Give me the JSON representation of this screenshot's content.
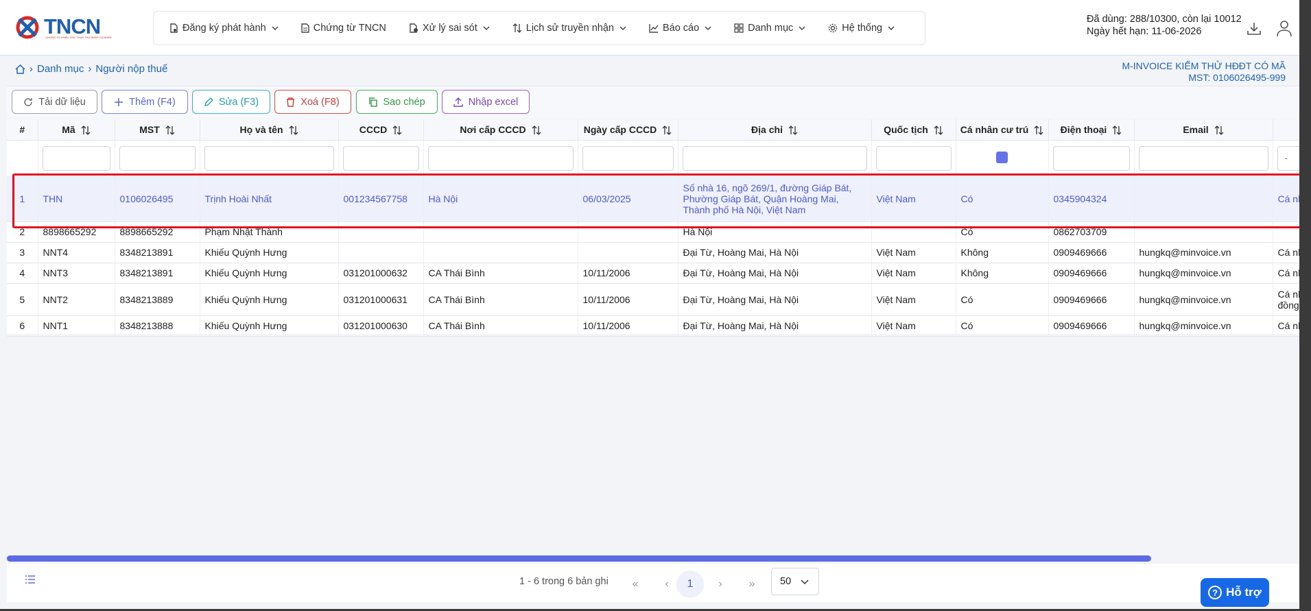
{
  "logo": {
    "text": "TNCN",
    "subtitle": "CHỨNG TỪ KHẤU TRỪ THUẾ THU NHẬP CÁ NHÂN"
  },
  "nav": [
    {
      "label": "Đăng ký phát hành",
      "icon": "file-settings-icon",
      "dropdown": true
    },
    {
      "label": "Chứng từ TNCN",
      "icon": "document-icon",
      "dropdown": false
    },
    {
      "label": "Xử lý sai sót",
      "icon": "file-error-icon",
      "dropdown": true
    },
    {
      "label": "Lịch sử truyền nhận",
      "icon": "transfer-icon",
      "dropdown": true
    },
    {
      "label": "Báo cáo",
      "icon": "chart-line-icon",
      "dropdown": true
    },
    {
      "label": "Danh mục",
      "icon": "grid-icon",
      "dropdown": true
    },
    {
      "label": "Hệ thống",
      "icon": "gear-icon",
      "dropdown": true
    }
  ],
  "usage": {
    "line1": "Đã dùng: 288/10300, còn lại 10012",
    "line2": "Ngày hết hạn: 11-06-2026"
  },
  "breadcrumb": {
    "items": [
      "Danh mục",
      "Người nộp thuế"
    ]
  },
  "company": {
    "name": "M-INVOICE KIỂM THỬ HĐĐT CÓ MÃ",
    "mst": "MST: 0106026495-999"
  },
  "toolbar": {
    "reload": "Tải dữ liệu",
    "add": "Thêm (F4)",
    "edit": "Sửa (F3)",
    "delete": "Xoá (F8)",
    "copy": "Sao chép",
    "import": "Nhập excel"
  },
  "colors": {
    "accent": "#5d6ae6",
    "primary_blue": "#1f63b5",
    "highlight_red": "#e0141e",
    "help_blue": "#1668e4"
  },
  "table": {
    "columns": [
      "#",
      "Mã",
      "MST",
      "Họ và tên",
      "CCCD",
      "Nơi cấp CCCD",
      "Ngày cấp CCCD",
      "Địa chỉ",
      "Quốc tịch",
      "Cá nhân cư trú",
      "Điện thoại",
      "Email",
      "-"
    ],
    "rows": [
      [
        "1",
        "THN",
        "0106026495",
        "Trịnh Hoài Nhất",
        "001234567758",
        "Hà Nội",
        "06/03/2025",
        "Số nhà 16, ngõ 269/1, đường Giáp Bát, Phường Giáp Bát, Quận Hoàng Mai, Thành phố Hà Nội, Việt Nam",
        "Việt Nam",
        "Có",
        "0345904324",
        "",
        "Cá nh"
      ],
      [
        "2",
        "8898665292",
        "8898665292",
        "Phạm Nhật Thành",
        "",
        "",
        "",
        "Hà Nội",
        "",
        "Có",
        "0862703709",
        "",
        ""
      ],
      [
        "3",
        "NNT4",
        "8348213891",
        "Khiếu Quỳnh Hưng",
        "",
        "",
        "",
        "Đại Từ, Hoàng Mai, Hà Nội",
        "Việt Nam",
        "Không",
        "0909469666",
        "hungkq@minvoice.vn",
        "Cá nh"
      ],
      [
        "4",
        "NNT3",
        "8348213891",
        "Khiếu Quỳnh Hưng",
        "031201000632",
        "CA Thái Bình",
        "10/11/2006",
        "Đại Từ, Hoàng Mai, Hà Nội",
        "Việt Nam",
        "Không",
        "0909469666",
        "hungkq@minvoice.vn",
        "Cá nh"
      ],
      [
        "5",
        "NNT2",
        "8348213889",
        "Khiếu Quỳnh Hưng",
        "031201000631",
        "CA Thái Bình",
        "10/11/2006",
        "Đại Từ, Hoàng Mai, Hà Nội",
        "Việt Nam",
        "Có",
        "0909469666",
        "hungkq@minvoice.vn",
        "Cá nh đồng"
      ],
      [
        "6",
        "NNT1",
        "8348213888",
        "Khiếu Quỳnh Hưng",
        "031201000630",
        "CA Thái Bình",
        "10/11/2006",
        "Đại Từ, Hoàng Mai, Hà Nội",
        "Việt Nam",
        "Có",
        "0909469666",
        "hungkq@minvoice.vn",
        "Cá nh"
      ]
    ]
  },
  "pager": {
    "info": "1 - 6 trong 6 bản ghi",
    "current_page": "1",
    "per_page": "50"
  },
  "help": {
    "label": "Hỗ trợ"
  }
}
